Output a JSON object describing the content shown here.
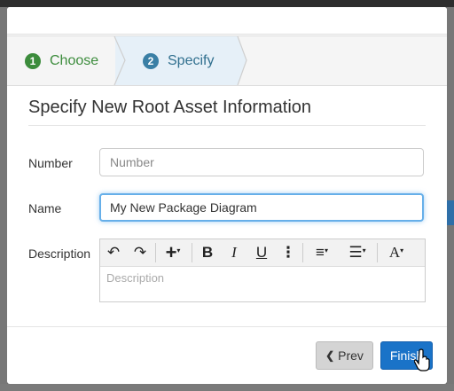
{
  "wizard": {
    "steps": [
      {
        "number": "1",
        "label": "Choose"
      },
      {
        "number": "2",
        "label": "Specify"
      }
    ]
  },
  "form": {
    "title": "Specify New Root Asset Information",
    "number_label": "Number",
    "number_value": "",
    "number_placeholder": "Number",
    "name_label": "Name",
    "name_value": "My New Package Diagram",
    "description_label": "Description",
    "description_placeholder": "Description"
  },
  "toolbar": {
    "undo": "↶",
    "redo": "↷",
    "insert": "+",
    "bold": "B",
    "italic": "I",
    "underline": "U",
    "more": "⋮",
    "align": "≡",
    "list": "☰",
    "font": "A"
  },
  "footer": {
    "prev_label": "Prev",
    "prev_icon": "❮",
    "finish_label": "Finish"
  },
  "colors": {
    "accent": "#1a73c8",
    "step_done": "#3c8c3c",
    "step_active": "#3a7fa5",
    "focus_ring": "#66afe9"
  }
}
